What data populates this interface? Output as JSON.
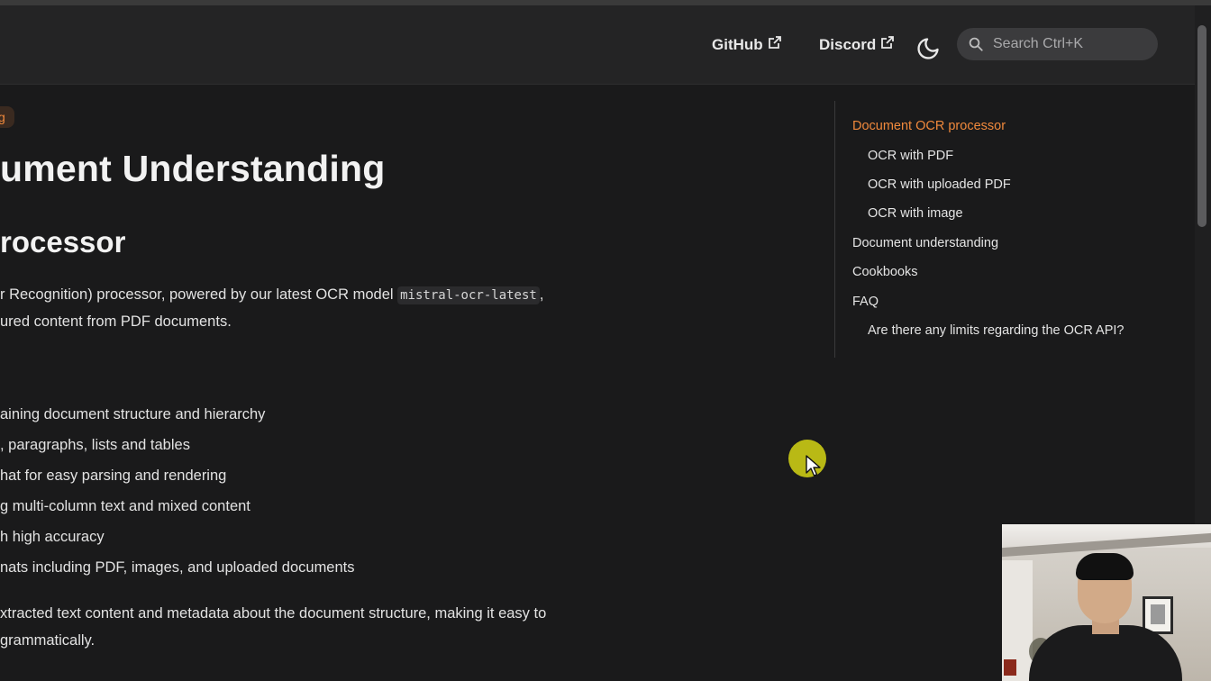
{
  "header": {
    "github_label": "GitHub",
    "discord_label": "Discord",
    "search_placeholder": "Search Ctrl+K"
  },
  "content": {
    "badge": "g",
    "title": "ument Understanding",
    "section_title": "rocessor",
    "intro_line1_before": "r Recognition) processor, powered by our latest OCR model ",
    "intro_code": "mistral-ocr-latest",
    "intro_line1_after": ",",
    "intro_line2": "ured content from PDF documents.",
    "bullets": [
      "aining document structure and hierarchy",
      ", paragraphs, lists and tables",
      "hat for easy parsing and rendering",
      "g multi-column text and mixed content",
      "h high accuracy",
      "nats including PDF, images, and uploaded documents"
    ],
    "outro_line1": "xtracted text content and metadata about the document structure, making it easy to",
    "outro_line2": "grammatically."
  },
  "toc": {
    "items": [
      {
        "label": "Document OCR processor",
        "active": true
      },
      {
        "label": "OCR with PDF"
      },
      {
        "label": "OCR with uploaded PDF"
      },
      {
        "label": "OCR with image"
      },
      {
        "label": "Document understanding"
      },
      {
        "label": "Cookbooks"
      },
      {
        "label": "FAQ"
      },
      {
        "label": "Are there any limits regarding the OCR API?"
      }
    ]
  },
  "colors": {
    "accent": "#f0893c",
    "background": "#1a1a1b",
    "header": "#242425",
    "cursor_highlight": "#d6d614"
  },
  "icons": {
    "external_link": "external-link-icon",
    "theme": "moon-icon",
    "search": "search-icon",
    "cursor": "pointer-cursor-icon"
  }
}
